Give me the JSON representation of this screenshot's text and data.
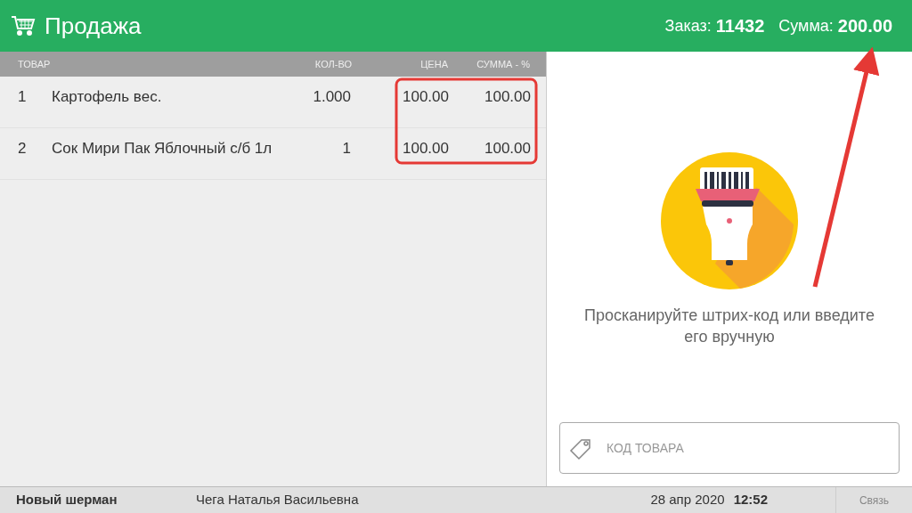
{
  "header": {
    "title": "Продажа",
    "order_label": "Заказ:",
    "order_number": "11432",
    "sum_label": "Сумма:",
    "sum_value": "200.00"
  },
  "table": {
    "columns": [
      "ТОВАР",
      "КОЛ-ВО",
      "ЦЕНА",
      "СУММА - %"
    ],
    "rows": [
      {
        "index": "1",
        "name": "Картофель вес.",
        "qty": "1.000",
        "price": "100.00",
        "sum": "100.00"
      },
      {
        "index": "2",
        "name": "Сок Мири Пак Яблочный с/б 1л",
        "qty": "1",
        "price": "100.00",
        "sum": "100.00"
      }
    ]
  },
  "scan_panel": {
    "message": "Просканируйте штрих-код или введите его вручную",
    "code_field": {
      "placeholder": "КОД ТОВАРА"
    }
  },
  "status_bar": {
    "store": "Новый шерман",
    "cashier": "Чега Наталья Васильевна",
    "date": "28 апр 2020",
    "time": "12:52",
    "connection": "Связь"
  }
}
